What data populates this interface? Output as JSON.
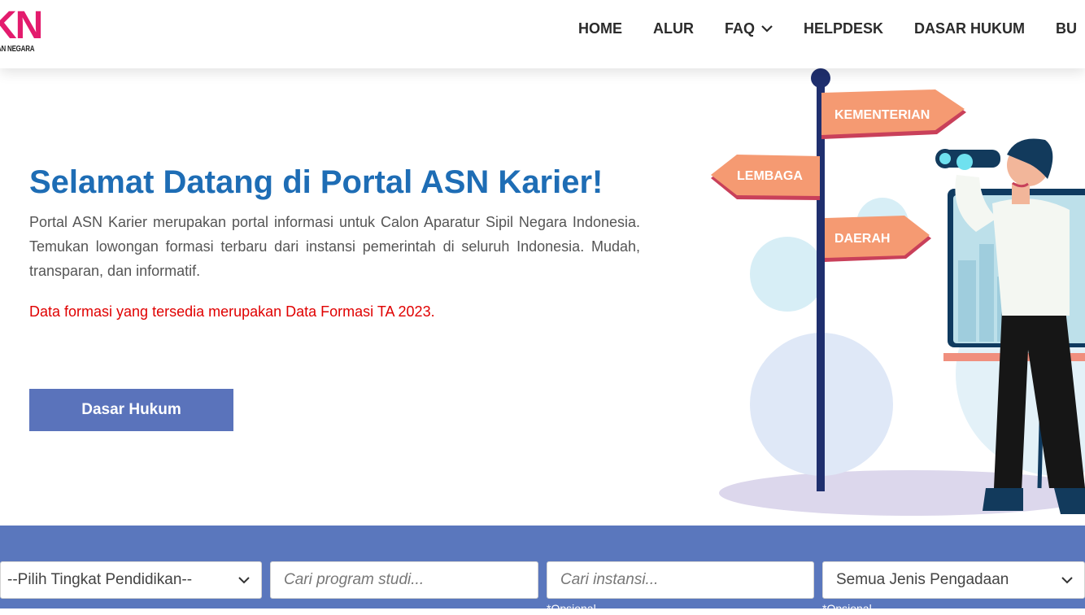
{
  "header": {
    "logo_mark": "KN",
    "logo_sub": "IAN NEGARA",
    "nav": [
      "HOME",
      "ALUR",
      "FAQ",
      "HELPDESK",
      "DASAR HUKUM",
      "BU"
    ],
    "brand_color": "#e31b6d"
  },
  "hero": {
    "title": "Selamat Datang di Portal ASN Karier!",
    "description": "Portal ASN Karier merupakan portal informasi untuk Calon Aparatur Sipil Negara Indonesia. Temukan lowongan formasi terbaru dari instansi pemerintah di seluruh Indonesia. Mudah, transparan, dan informatif.",
    "note": "Data formasi yang tersedia merupakan Data Formasi TA 2023.",
    "button_label": "Dasar Hukum"
  },
  "illustration": {
    "signs": [
      "KEMENTERIAN",
      "LEMBAGA",
      "DAERAH"
    ]
  },
  "search": {
    "education_select": "--Pilih Tingkat Pendidikan--",
    "program_placeholder": "Cari program studi...",
    "instansi_placeholder": "Cari instansi...",
    "procurement_select": "Semua Jenis Pengadaan",
    "note_instansi": "*Opsional",
    "note_procurement": "*Opsional"
  },
  "colors": {
    "title": "#1e6db5",
    "button": "#5a73bb",
    "search_band": "#5a77bd",
    "note": "#e00000"
  }
}
